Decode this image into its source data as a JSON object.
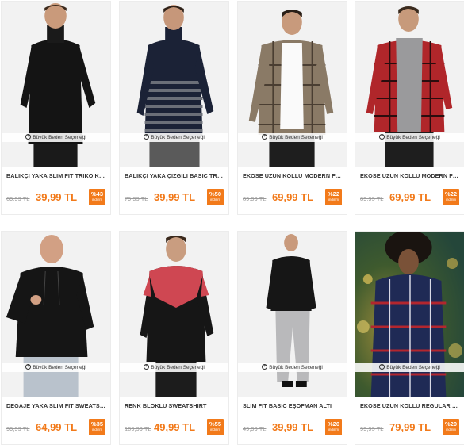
{
  "size_badge_label": "Büyük Beden Seçeneği",
  "brand": {
    "accent": "#f27a1a",
    "muted": "#9a9a9a"
  },
  "products": [
    {
      "title": "BALIKÇI YAKA SLIM FIT TRIKO KAZAK",
      "old_price": "69,99 TL",
      "price": "39,99 TL",
      "discount": "%43",
      "discount_label": "indirim"
    },
    {
      "title": "BALIKÇI YAKA ÇIZGILI BASIC TRIKO K...",
      "old_price": "79,99 TL",
      "price": "39,99 TL",
      "discount": "%50",
      "discount_label": "indirim"
    },
    {
      "title": "EKOSE UZUN KOLLU MODERN FIT GÖ...",
      "old_price": "89,99 TL",
      "price": "69,99 TL",
      "discount": "%22",
      "discount_label": "indirim"
    },
    {
      "title": "EKOSE UZUN KOLLU MODERN FIT GÖ...",
      "old_price": "89,99 TL",
      "price": "69,99 TL",
      "discount": "%22",
      "discount_label": "indirim"
    },
    {
      "title": "DEGAJE YAKA SLIM FIT SWEATSHIRT",
      "old_price": "99,99 TL",
      "price": "64,99 TL",
      "discount": "%35",
      "discount_label": "indirim"
    },
    {
      "title": "RENK BLOKLU SWEATSHIRT",
      "old_price": "109,99 TL",
      "price": "49,99 TL",
      "discount": "%55",
      "discount_label": "indirim"
    },
    {
      "title": "SLIM FIT BASIC EŞOFMAN ALTI",
      "old_price": "49,99 TL",
      "price": "39,99 TL",
      "discount": "%20",
      "discount_label": "indirim"
    },
    {
      "title": "EKOSE UZUN KOLLU REGULAR FIT GÖ...",
      "old_price": "99,99 TL",
      "price": "79,99 TL",
      "discount": "%20",
      "discount_label": "indirim"
    }
  ]
}
